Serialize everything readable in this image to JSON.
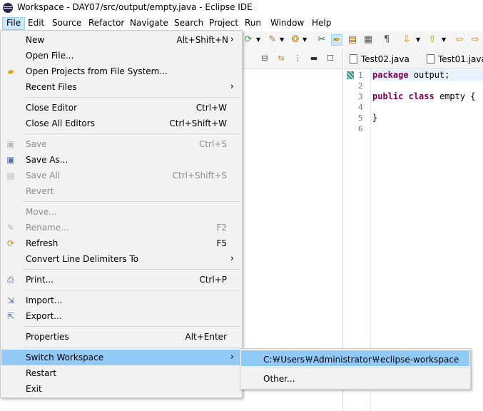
{
  "window": {
    "title": "Workspace - DAY07/src/output/empty.java - Eclipse IDE"
  },
  "menubar": {
    "items": [
      "File",
      "Edit",
      "Source",
      "Refactor",
      "Navigate",
      "Search",
      "Project",
      "Run",
      "Window",
      "Help"
    ]
  },
  "file_menu": {
    "new": {
      "label": "New",
      "shortcut": "Alt+Shift+N"
    },
    "open_file": {
      "label": "Open File..."
    },
    "open_projects": {
      "label": "Open Projects from File System..."
    },
    "recent_files": {
      "label": "Recent Files"
    },
    "close_editor": {
      "label": "Close Editor",
      "shortcut": "Ctrl+W"
    },
    "close_all_editors": {
      "label": "Close All Editors",
      "shortcut": "Ctrl+Shift+W"
    },
    "save": {
      "label": "Save",
      "shortcut": "Ctrl+S"
    },
    "save_as": {
      "label": "Save As..."
    },
    "save_all": {
      "label": "Save All",
      "shortcut": "Ctrl+Shift+S"
    },
    "revert": {
      "label": "Revert"
    },
    "move": {
      "label": "Move..."
    },
    "rename": {
      "label": "Rename...",
      "shortcut": "F2"
    },
    "refresh": {
      "label": "Refresh",
      "shortcut": "F5"
    },
    "convert_line_delimiters": {
      "label": "Convert Line Delimiters To"
    },
    "print": {
      "label": "Print...",
      "shortcut": "Ctrl+P"
    },
    "import": {
      "label": "Import..."
    },
    "export": {
      "label": "Export..."
    },
    "properties": {
      "label": "Properties",
      "shortcut": "Alt+Enter"
    },
    "switch_workspace": {
      "label": "Switch Workspace"
    },
    "restart": {
      "label": "Restart"
    },
    "exit": {
      "label": "Exit"
    }
  },
  "switch_workspace_submenu": {
    "items": [
      "C:￦Users￦Administrator￦eclipse-workspace",
      "Other..."
    ]
  },
  "editor": {
    "tabs": [
      "Test02.java",
      "Test01.java"
    ],
    "line_numbers": [
      "1",
      "2",
      "3",
      "4",
      "5",
      "6"
    ],
    "code": {
      "line1_kw": "package",
      "line1_rest": " output;",
      "line3_kw1": "public",
      "line3_kw2": "class",
      "line3_rest": " empty {",
      "line5": "}"
    }
  },
  "colors": {
    "menu_highlight": "#91c9f7",
    "menubar_active": "#cce8ff",
    "keyword": "#7f0055",
    "current_line": "#e8f2fe"
  }
}
